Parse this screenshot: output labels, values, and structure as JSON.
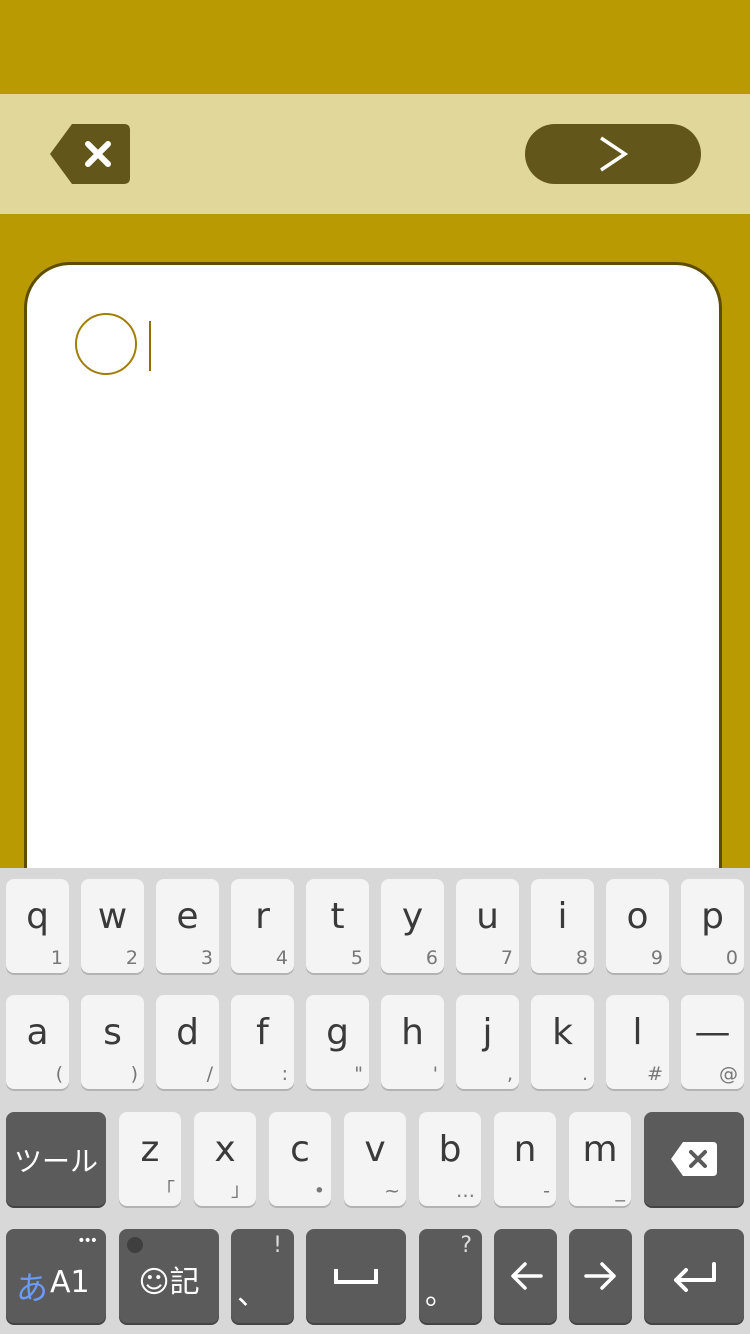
{
  "toolbar": {
    "delete_icon": "delete-tag-icon",
    "next_icon": "chevron-right-icon",
    "colors": {
      "bar": "#e1d79b",
      "button": "#62561a",
      "background": "#b99a02"
    }
  },
  "editor": {
    "value": "",
    "marker_icon": "circle-outline-icon"
  },
  "keyboard": {
    "row1": [
      {
        "main": "q",
        "sub": "1"
      },
      {
        "main": "w",
        "sub": "2"
      },
      {
        "main": "e",
        "sub": "3"
      },
      {
        "main": "r",
        "sub": "4"
      },
      {
        "main": "t",
        "sub": "5"
      },
      {
        "main": "y",
        "sub": "6"
      },
      {
        "main": "u",
        "sub": "7"
      },
      {
        "main": "i",
        "sub": "8"
      },
      {
        "main": "o",
        "sub": "9"
      },
      {
        "main": "p",
        "sub": "0"
      }
    ],
    "row2": [
      {
        "main": "a",
        "sub": "("
      },
      {
        "main": "s",
        "sub": ")"
      },
      {
        "main": "d",
        "sub": "/"
      },
      {
        "main": "f",
        "sub": ":"
      },
      {
        "main": "g",
        "sub": "\""
      },
      {
        "main": "h",
        "sub": "'"
      },
      {
        "main": "j",
        "sub": ","
      },
      {
        "main": "k",
        "sub": "."
      },
      {
        "main": "l",
        "sub": "#"
      },
      {
        "main": "—",
        "sub": "@"
      }
    ],
    "row3": [
      {
        "main": "z",
        "sub": "「"
      },
      {
        "main": "x",
        "sub": "」"
      },
      {
        "main": "c",
        "sub": "•"
      },
      {
        "main": "v",
        "sub": "~"
      },
      {
        "main": "b",
        "sub": "…"
      },
      {
        "main": "n",
        "sub": "-"
      },
      {
        "main": "m",
        "sub": "_"
      }
    ],
    "tool_label": "ツール",
    "mode_label_kana": "あ",
    "mode_label_alpha": "A1",
    "mode_dots": "•••",
    "emoji_label": "☺記",
    "comma_label": "、",
    "comma_sub": "!",
    "period_label": "。",
    "period_sub": "?",
    "icons": {
      "backspace": "backspace-icon",
      "space": "space-bar-icon",
      "left": "arrow-left-icon",
      "right": "arrow-right-icon",
      "enter": "enter-icon"
    }
  }
}
